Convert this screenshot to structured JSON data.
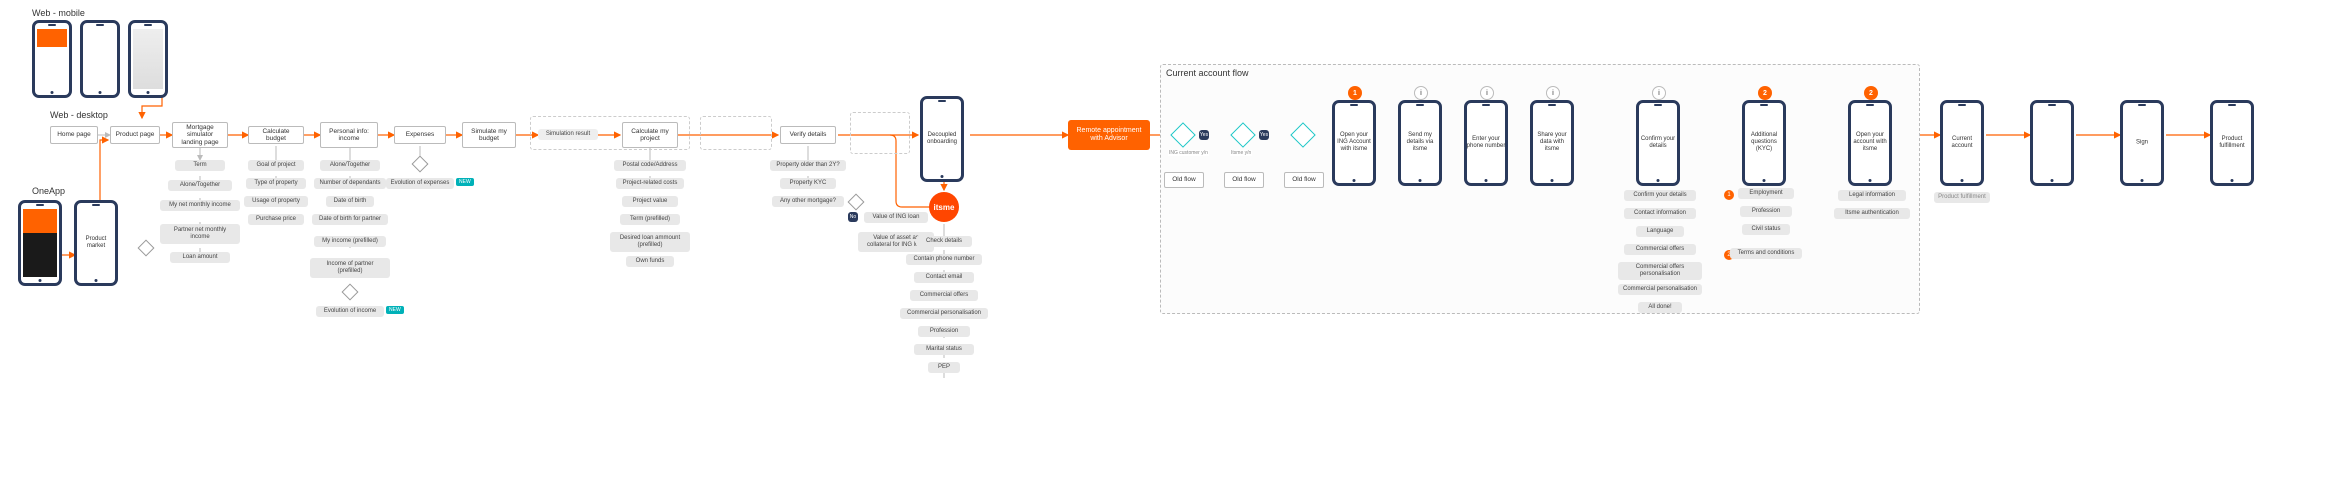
{
  "sections": {
    "web_mobile": "Web - mobile",
    "web_desktop": "Web - desktop",
    "one_app": "OneApp"
  },
  "left_nodes": {
    "home": "Home page",
    "product": "Product page",
    "mortgage_sim": "Mortgage simulator landing page",
    "product_market": "Product market"
  },
  "simulator_cols": {
    "calc_budget": "Calculate budget",
    "personal_info": "Personal info: income",
    "expenses": "Expenses",
    "simulate": "Simulate my budget"
  },
  "sim_chips": {
    "term": "Term",
    "alone": "Alone/Together",
    "net_income": "My net monthly income",
    "partner_income": "Partner net monthly income",
    "loan_amount": "Loan amount",
    "goal": "Goal of project",
    "type_prop": "Type of property",
    "usage_prop": "Usage of property",
    "purchase_price": "Purchase price",
    "alone2": "Alone/Together",
    "dependants": "Number of dependants",
    "dob": "Date of birth",
    "dob_partner": "Date of birth for partner",
    "my_inc_pre": "My income (prefilled)",
    "partner_inc_pre": "Income of partner (prefilled)",
    "eval_income": "Evolution of income",
    "eval_exp": "Evolution of expenses"
  },
  "sim_result": {
    "label": "Simulation result",
    "calc_project": "Calculate my project",
    "postal": "Postal code/Address",
    "proj_cost": "Project‑related costs",
    "proj_value": "Project value",
    "term_pre": "Term (prefilled)",
    "loan_pre": "Desired loan ammount (prefilled)",
    "own_funds": "Own funds"
  },
  "verify": {
    "node": "Verify details",
    "older": "Property older than 2Y?",
    "kyc": "Property KYC",
    "other_mort": "Any other mortgage?",
    "ing_value": "Value of ING loan",
    "asset_value": "Value of asset as collateral for ING loan"
  },
  "onboarding": {
    "title": "Decoupled onboarding",
    "itsme": "itsme",
    "check": "Check details",
    "contain_phone": "Contain phone number",
    "contact_email": "Contact email",
    "comm_offers": "Commercial offers",
    "comm_pers": "Commercial personalisation",
    "profession": "Profession",
    "marital": "Marital status",
    "pep": "PEP"
  },
  "appointment": "Remote appointment with Advisor",
  "ca_flow": {
    "title": "Current account flow",
    "old_flow": "Old flow",
    "step1": "Open your ING Account with itsme",
    "step2": "Send my details via itsme",
    "step3": "Enter your phone number",
    "step4": "Share your data with itsme",
    "step5": "Confirm your details",
    "step6": "Additional questions (KYC)",
    "step7": "Open your account with itsme",
    "confirm_chips": {
      "confirm_det": "Confirm your details",
      "contact_info": "Contact information",
      "language": "Language",
      "comm_offers": "Commercial offers",
      "comm_offers_pers": "Commercial offers personalisation",
      "comm_pers": "Commercial personalisation",
      "all_done": "All done!"
    },
    "kyc_chips": {
      "employment": "Employment",
      "profession": "Profession",
      "civil": "Civil status",
      "tc": "Terms and conditions"
    },
    "open_chips": {
      "legal": "Legal information",
      "auth": "Itsme authentication"
    }
  },
  "tail": {
    "ca": "Current account",
    "pf": "Product fulfillment",
    "sign": "Sign",
    "pf2": "Product fulfillment"
  },
  "badges": {
    "b1": "1",
    "b2": "2",
    "i": "i"
  },
  "yesno": {
    "yes": "Yes",
    "no": "No"
  },
  "decisions": {
    "cust_yn": "ING customer y/n",
    "itsme_yn": "Itsme y/n"
  },
  "tags": {
    "new": "NEW"
  }
}
